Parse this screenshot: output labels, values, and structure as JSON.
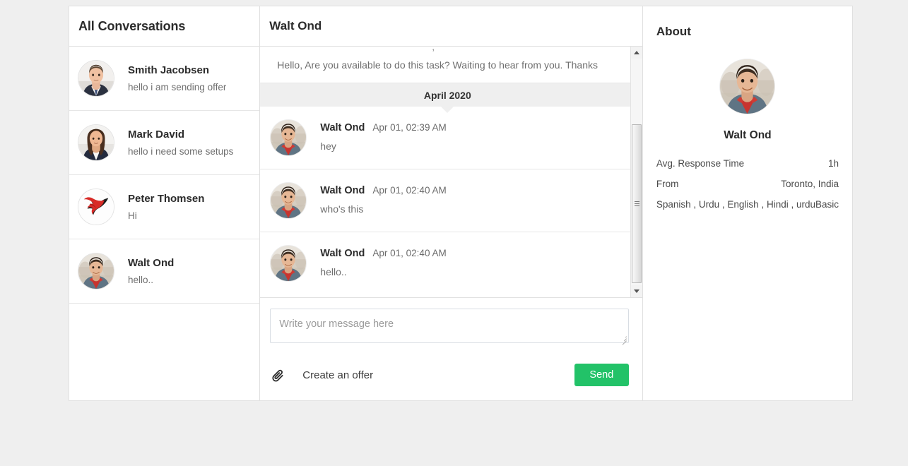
{
  "conversations": {
    "title": "All Conversations",
    "items": [
      {
        "name": "Smith Jacobsen",
        "snippet": "hello i am sending offer",
        "avatar": "man-suit-photo"
      },
      {
        "name": "Mark David",
        "snippet": "hello i need some setups",
        "avatar": "woman-photo"
      },
      {
        "name": "Peter Thomsen",
        "snippet": "Hi",
        "avatar": "red-black-bird-logo"
      },
      {
        "name": "Walt Ond",
        "snippet": "hello..",
        "avatar": "man-sweater-photo"
      }
    ]
  },
  "thread": {
    "title": "Walt Ond",
    "clipped_message": {
      "text": "Hello, Are you available to do this task? Waiting to hear from you. Thanks",
      "ghost": ","
    },
    "date_divider": "April 2020",
    "messages": [
      {
        "author": "Walt Ond",
        "time": "Apr 01, 02:39 AM",
        "text": "hey",
        "avatar": "man-sweater-photo"
      },
      {
        "author": "Walt Ond",
        "time": "Apr 01, 02:40 AM",
        "text": "who's this",
        "avatar": "man-sweater-photo"
      },
      {
        "author": "Walt Ond",
        "time": "Apr 01, 02:40 AM",
        "text": "hello..",
        "avatar": "man-sweater-photo"
      }
    ],
    "scrollbar": {
      "up_icon": "triangle-up-icon",
      "down_icon": "triangle-down-icon"
    }
  },
  "composer": {
    "placeholder": "Write your message here",
    "value": "",
    "offer_icon": "paperclip-icon",
    "offer_label": "Create an offer",
    "send_label": "Send",
    "send_color": "#22c268"
  },
  "about": {
    "title": "About",
    "name": "Walt Ond",
    "avatar": "man-sweater-photo",
    "rows": [
      {
        "key": "Avg. Response Time",
        "value": "1h"
      },
      {
        "key": "From",
        "value": "Toronto, India"
      },
      {
        "key": "Spanish , Urdu , English , Hindi , urdu",
        "value": "Basic"
      }
    ]
  }
}
